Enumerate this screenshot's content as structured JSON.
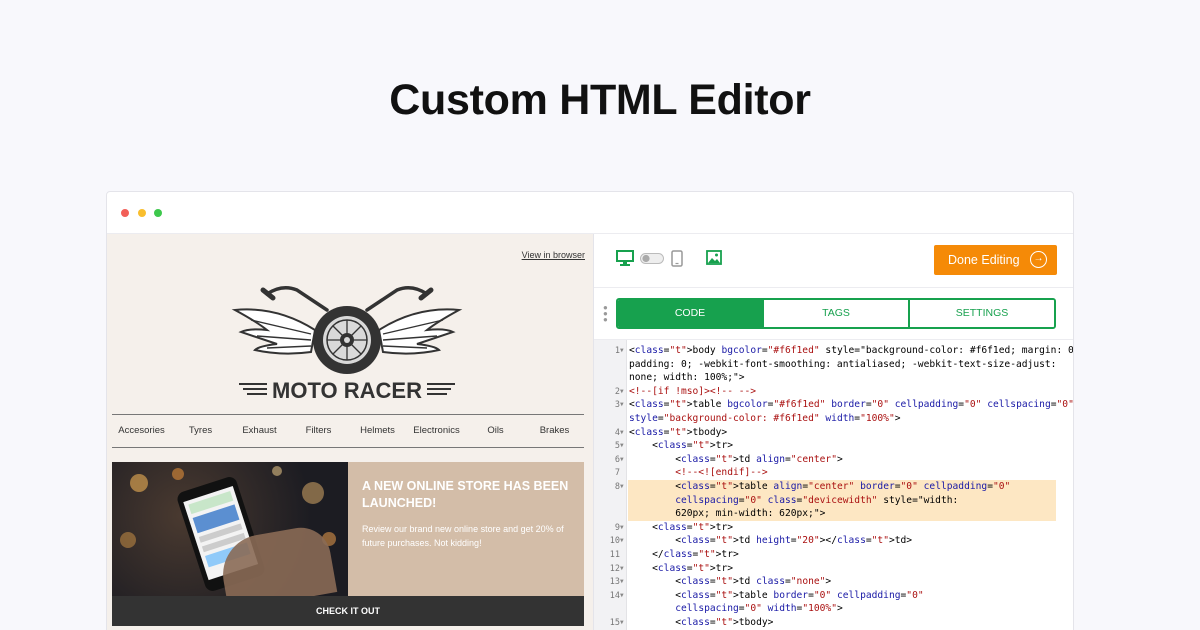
{
  "page": {
    "title": "Custom HTML Editor"
  },
  "preview": {
    "view_in_browser": "View in browser",
    "brand": "MOTO RACER",
    "nav": [
      "Accesories",
      "Tyres",
      "Exhaust",
      "Filters",
      "Helmets",
      "Electronics",
      "Oils",
      "Brakes"
    ],
    "promo": {
      "title": "A NEW ONLINE STORE HAS BEEN LAUNCHED!",
      "body": "Review our brand new online store and get 20% of future purchases. Not kidding!",
      "button": "CHECK IT OUT"
    }
  },
  "editor": {
    "toolbar": {
      "desktop_icon": "desktop-icon",
      "toggle_icon": "toggle-icon",
      "mobile_icon": "mobile-icon",
      "image_icon": "image-icon",
      "done_label": "Done Editing",
      "accent_color": "#f58a07"
    },
    "tabs": [
      "CODE",
      "TAGS",
      "SETTINGS"
    ],
    "active_tab": "CODE",
    "tab_color": "#17a14e",
    "code_lines": [
      {
        "n": "1",
        "fold": true,
        "text": "<body bgcolor=\"#f6f1ed\" style=\"background-color: #f6f1ed; margin: 0;"
      },
      {
        "n": "",
        "fold": false,
        "text": "padding: 0; -webkit-font-smoothing: antialiased; -webkit-text-size-adjust:"
      },
      {
        "n": "",
        "fold": false,
        "text": "none; width: 100%;\">"
      },
      {
        "n": "2",
        "fold": true,
        "text": "<!--[if !mso]><!-- -->"
      },
      {
        "n": "3",
        "fold": true,
        "text": "<table bgcolor=\"#f6f1ed\" border=\"0\" cellpadding=\"0\" cellspacing=\"0\""
      },
      {
        "n": "",
        "fold": false,
        "text": "style=\"background-color: #f6f1ed\" width=\"100%\">"
      },
      {
        "n": "4",
        "fold": true,
        "text": "<tbody>"
      },
      {
        "n": "5",
        "fold": true,
        "text": "    <tr>"
      },
      {
        "n": "6",
        "fold": true,
        "text": "        <td align=\"center\">"
      },
      {
        "n": "7",
        "fold": false,
        "text": "        <!--<![endif]-->"
      },
      {
        "n": "8",
        "fold": true,
        "text": "        <table align=\"center\" border=\"0\" cellpadding=\"0\"",
        "highlight": true
      },
      {
        "n": "",
        "fold": false,
        "text": "        cellspacing=\"0\" class=\"devicewidth\" style=\"width:",
        "highlight": true
      },
      {
        "n": "",
        "fold": false,
        "text": "        620px; min-width: 620px;\">",
        "highlight": true
      },
      {
        "n": "9",
        "fold": true,
        "text": "    <tr>"
      },
      {
        "n": "10",
        "fold": true,
        "text": "        <td height=\"20\"></td>"
      },
      {
        "n": "11",
        "fold": false,
        "text": "    </tr>"
      },
      {
        "n": "12",
        "fold": true,
        "text": "    <tr>"
      },
      {
        "n": "13",
        "fold": true,
        "text": "        <td class=\"none\">"
      },
      {
        "n": "14",
        "fold": true,
        "text": "        <table border=\"0\" cellpadding=\"0\""
      },
      {
        "n": "",
        "fold": false,
        "text": "        cellspacing=\"0\" width=\"100%\">"
      },
      {
        "n": "15",
        "fold": true,
        "text": "        <tbody>"
      }
    ]
  }
}
